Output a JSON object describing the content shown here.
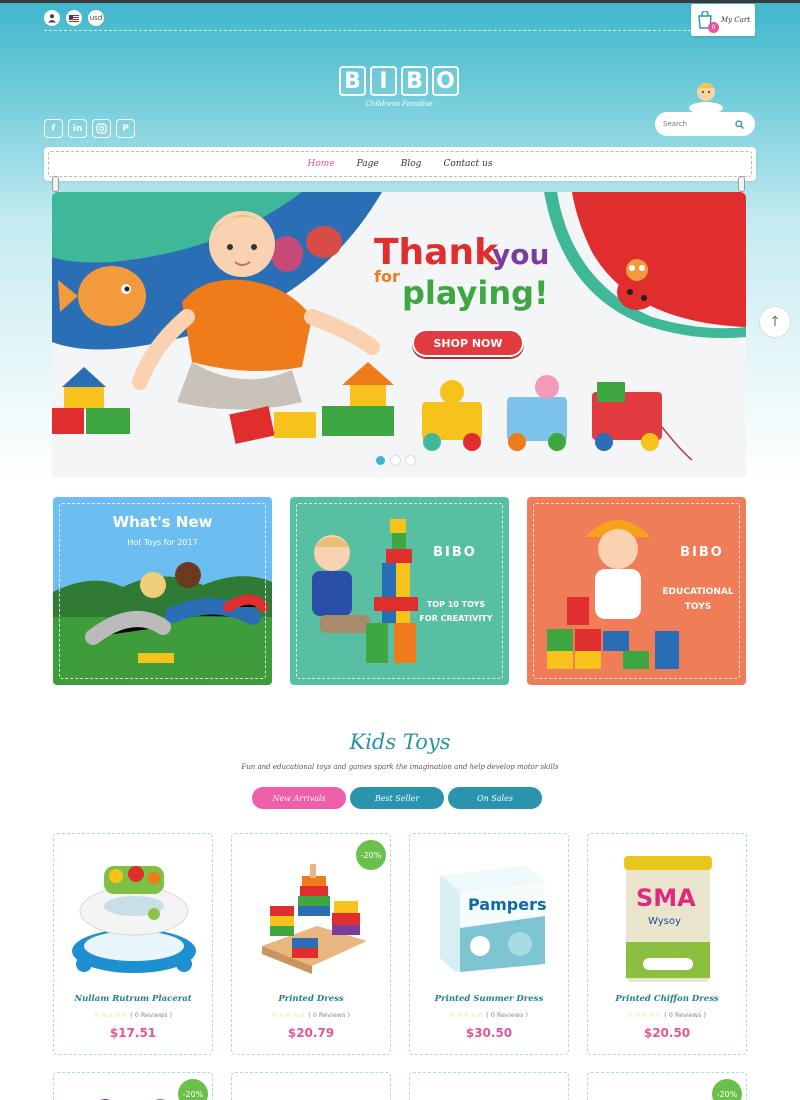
{
  "header": {
    "currency": "usd",
    "cart_label": "My Cart",
    "cart_count": "0",
    "logo_letters": [
      "B",
      "I",
      "B",
      "O"
    ],
    "tagline": "Childrens Paradise",
    "search_placeholder": "Search"
  },
  "nav": {
    "items": [
      "Home",
      "Page",
      "Blog",
      "Contact us"
    ]
  },
  "banner": {
    "headline_1": "Thank",
    "headline_2": "you",
    "headline_3": "for",
    "headline_4": "playing!",
    "cta": "SHOP NOW"
  },
  "promos": [
    {
      "title": "What's New",
      "subtitle": "Hot Toys for 2017"
    },
    {
      "logo": "BIBO",
      "title_1": "TOP 10 TOYS",
      "title_2": "FOR CREATIVITY"
    },
    {
      "logo": "BIBO",
      "title_1": "EDUCATIONAL",
      "title_2": "TOYS"
    }
  ],
  "section": {
    "title": "Kids Toys",
    "subtitle": "Fun and educational toys and games spark the imagination and help develop motor skills",
    "tabs": [
      "New Arrivals",
      "Best Seller",
      "On Sales"
    ]
  },
  "products": [
    {
      "name": "Nullam Rutrum Placerat",
      "reviews": "( 0 Reviews )",
      "price": "$17.51",
      "badge": ""
    },
    {
      "name": "Printed Dress",
      "reviews": "( 0 Reviews )",
      "price": "$20.79",
      "badge": "-20%"
    },
    {
      "name": "Printed Summer Dress",
      "reviews": "( 0 Reviews )",
      "price": "$30.50",
      "badge": ""
    },
    {
      "name": "Printed Chiffon Dress",
      "reviews": "( 0 Reviews )",
      "price": "$20.50",
      "badge": ""
    }
  ],
  "products_row2": [
    {
      "badge": "-20%"
    },
    {
      "badge": ""
    },
    {
      "badge": ""
    },
    {
      "badge": "-20%"
    }
  ],
  "product_images": {
    "pampers_text": "Pampers",
    "sma_text": "SMA",
    "sma_sub": "Wysoy"
  },
  "slider": {
    "active_index": 1,
    "count": 3
  }
}
